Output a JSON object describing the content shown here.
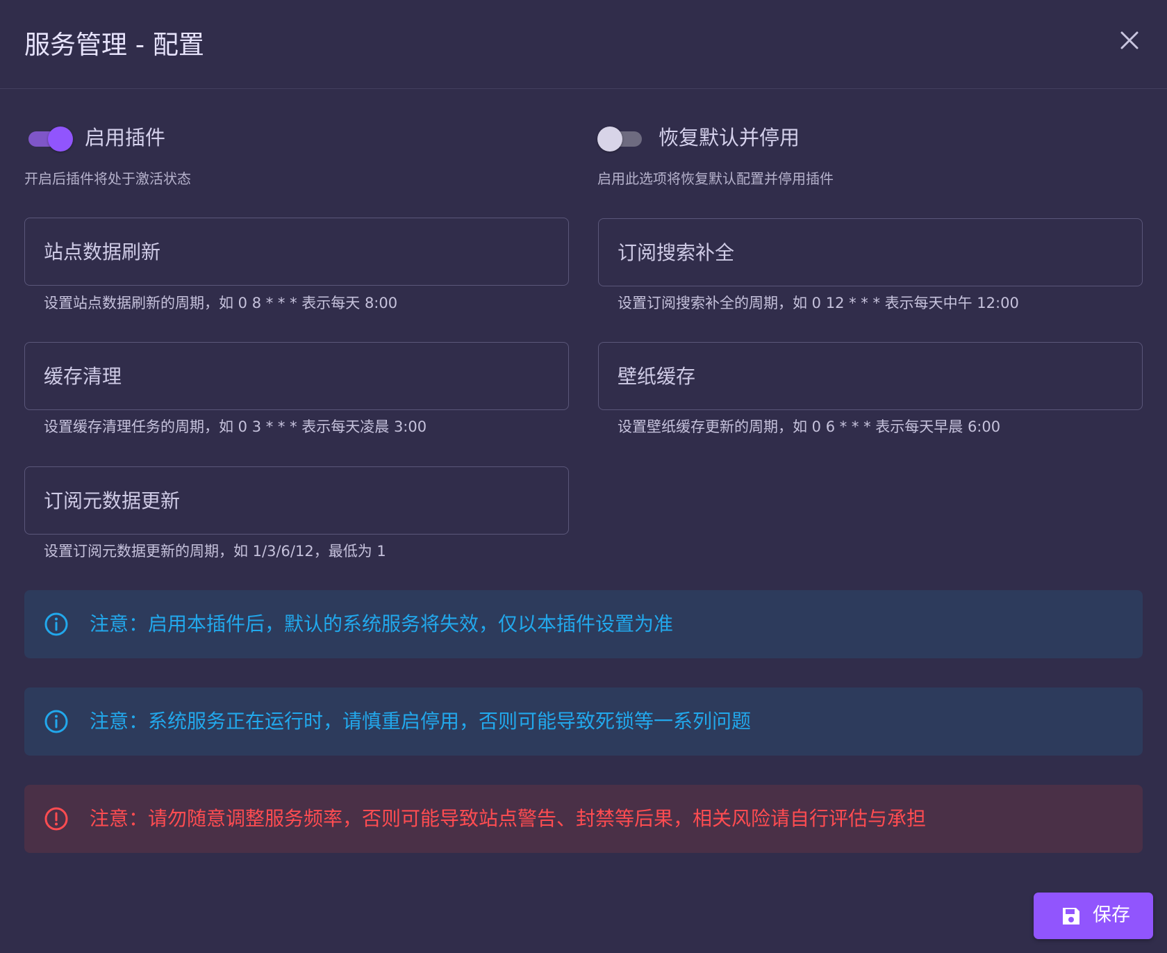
{
  "dialog": {
    "title": "服务管理 - 配置",
    "close_icon": "close-icon"
  },
  "toggles": {
    "enable_plugin": {
      "label": "启用插件",
      "hint": "开启后插件将处于激活状态",
      "checked": true
    },
    "restore_default": {
      "label": "恢复默认并停用",
      "hint": "启用此选项将恢复默认配置并停用插件",
      "checked": false
    }
  },
  "fields": {
    "site_refresh": {
      "placeholder": "站点数据刷新",
      "value": "",
      "hint": "设置站点数据刷新的周期，如 0 8 * * * 表示每天 8:00"
    },
    "subscribe_search": {
      "placeholder": "订阅搜索补全",
      "value": "",
      "hint": "设置订阅搜索补全的周期，如 0 12 * * * 表示每天中午 12:00"
    },
    "cache_clean": {
      "placeholder": "缓存清理",
      "value": "",
      "hint": "设置缓存清理任务的周期，如 0 3 * * * 表示每天凌晨 3:00"
    },
    "wallpaper_cache": {
      "placeholder": "壁纸缓存",
      "value": "",
      "hint": "设置壁纸缓存更新的周期，如 0 6 * * * 表示每天早晨 6:00"
    },
    "subscribe_meta": {
      "placeholder": "订阅元数据更新",
      "value": "",
      "hint": "设置订阅元数据更新的周期，如 1/3/6/12，最低为 1"
    }
  },
  "alerts": [
    {
      "type": "info",
      "icon": "info-icon",
      "text": "注意：启用本插件后，默认的系统服务将失效，仅以本插件设置为准"
    },
    {
      "type": "info",
      "icon": "info-icon",
      "text": "注意：系统服务正在运行时，请慎重启停用，否则可能导致死锁等一系列问题"
    },
    {
      "type": "error",
      "icon": "alert-circle-icon",
      "text": "注意：请勿随意调整服务频率，否则可能导致站点警告、封禁等后果，相关风险请自行评估与承担"
    }
  ],
  "actions": {
    "save_label": "保存",
    "save_icon": "save-icon"
  },
  "colors": {
    "primary": "#9155fd",
    "info": "#22a8ec",
    "error": "#ff4c51",
    "background": "#312d4b"
  }
}
